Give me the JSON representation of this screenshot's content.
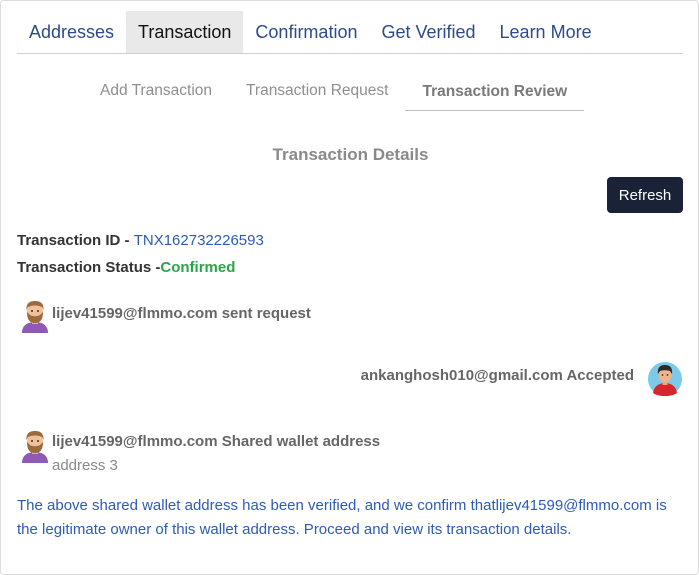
{
  "tabs": [
    "Addresses",
    "Transaction",
    "Confirmation",
    "Get Verified",
    "Learn More"
  ],
  "sub_tabs": [
    "Add Transaction",
    "Transaction Request",
    "Transaction Review"
  ],
  "section_title": "Transaction Details",
  "refresh_label": "Refresh",
  "transaction": {
    "id_label": "Transaction ID - ",
    "id_value": "TNX162732226593",
    "status_label": "Transaction Status -",
    "status_value": "Confirmed"
  },
  "events": {
    "sent": "lijev41599@flmmo.com sent request",
    "accepted": "ankanghosh010@gmail.com Accepted",
    "shared": "lijev41599@flmmo.com Shared wallet address",
    "shared_address": "address 3"
  },
  "verification_message": "The above shared wallet address has been verified, and we confirm thatlijev41599@flmmo.com is the legitimate owner of this wallet address. Proceed and view its transaction details.",
  "colors": {
    "link": "#2c5cb4",
    "confirmed": "#2aa54a",
    "button_bg": "#1a2238"
  },
  "icons": [
    "bearded-user-avatar-icon",
    "red-hoodie-user-avatar-icon"
  ]
}
